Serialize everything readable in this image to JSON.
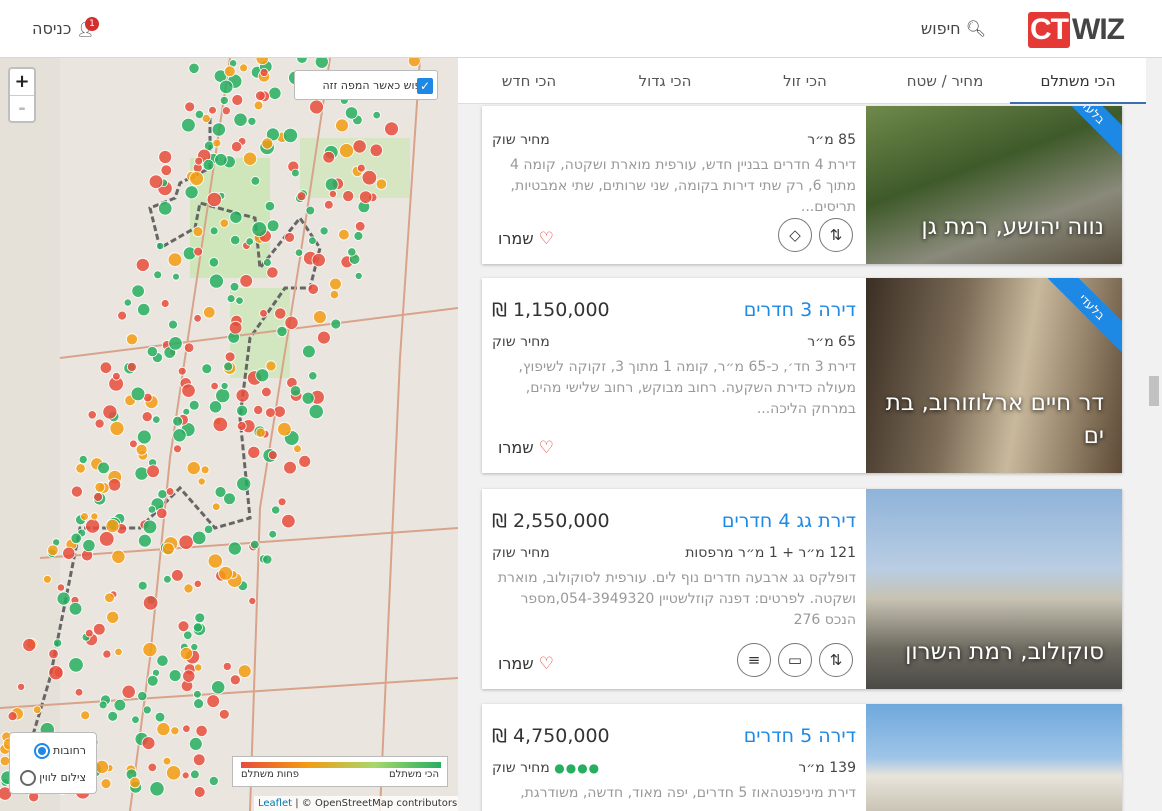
{
  "header": {
    "logo_ct": "CT",
    "logo_wiz": "WIZ",
    "search_label": "חיפוש",
    "login_label": "כניסה",
    "notifications": "1"
  },
  "map": {
    "zoom_in": "+",
    "zoom_out": "-",
    "search_on_move_label": "חיפוש כאשר המפה זזה",
    "search_on_move_checked": true,
    "mode_neighborhoods": "רחובות",
    "mode_satellite": "צילום לווין",
    "legend_most_worth": "הכי משתלם",
    "legend_least_worth": "פחות משתלם",
    "attribution_leaflet": "Leaflet",
    "attribution_osm": "| © OpenStreetMap contributors",
    "colors": {
      "cheap": "#27ae60",
      "mid": "#f39c12",
      "expensive": "#e74c3c",
      "boundary": "#666666",
      "park": "#c8e6b0"
    }
  },
  "tabs": [
    {
      "label": "הכי משתלם",
      "active": true
    },
    {
      "label": "מחיר / שטח",
      "active": false
    },
    {
      "label": "הכי זול",
      "active": false
    },
    {
      "label": "הכי גדול",
      "active": false
    },
    {
      "label": "הכי חדש",
      "active": false
    }
  ],
  "listings": [
    {
      "title": "",
      "price": "",
      "area": "85 מ״ר",
      "market": "מחיר שוק",
      "description": "דירת 4 חדרים בבניין חדש, עורפית מוארת ושקטה, קומה 4 מתוך 6, רק שתי דירות בקומה, שני שרותים, שתי אמבטיות, תריסים...",
      "location": "נווה יהושע, רמת גן",
      "ribbon": "בלעדי",
      "save_label": "שמרו",
      "features": [
        "elevator-icon",
        "diamond-icon"
      ]
    },
    {
      "title": "דירה 3 חדרים",
      "price": "₪ 1,150,000",
      "area": "65 מ״ר",
      "market": "מחיר שוק",
      "description": "דירת 3 חד׳, כ-65 מ״ר, קומה 1 מתוך 3, זקוקה לשיפוץ, מעולה כדירת השקעה. רחוב מבוקש, רחוב שלישי מהים, במרחק הליכה...",
      "location": "דר חיים ארלוזורוב, בת ים",
      "ribbon": "בלעדי",
      "save_label": "שמרו",
      "features": []
    },
    {
      "title": "דירת גג 4 חדרים",
      "price": "₪ 2,550,000",
      "area": "121 מ״ר + 1 מ״ר מרפסות",
      "market": "מחיר שוק",
      "description": "דופלקס גג ארבעה חדרים נוף לים. עורפית לסוקולוב, מוארת ושקטה. לפרטים: דפנה קוזלשטיין 054-3949320,מספר הנכס 276",
      "location": "סוקולוב, רמת השרון",
      "ribbon": "",
      "save_label": "שמרו",
      "features": [
        "elevator-icon",
        "car-icon",
        "storage-icon"
      ]
    },
    {
      "title": "דירה 5 חדרים",
      "price": "₪ 4,750,000",
      "area": "139 מ״ר",
      "market": "מחיר שוק",
      "description": "דירת מיניפנטהאוז 5 חדרים, יפה מאוד, חדשה, משודרגת,",
      "location": "",
      "ribbon": "",
      "save_label": "שמרו",
      "features": []
    }
  ]
}
